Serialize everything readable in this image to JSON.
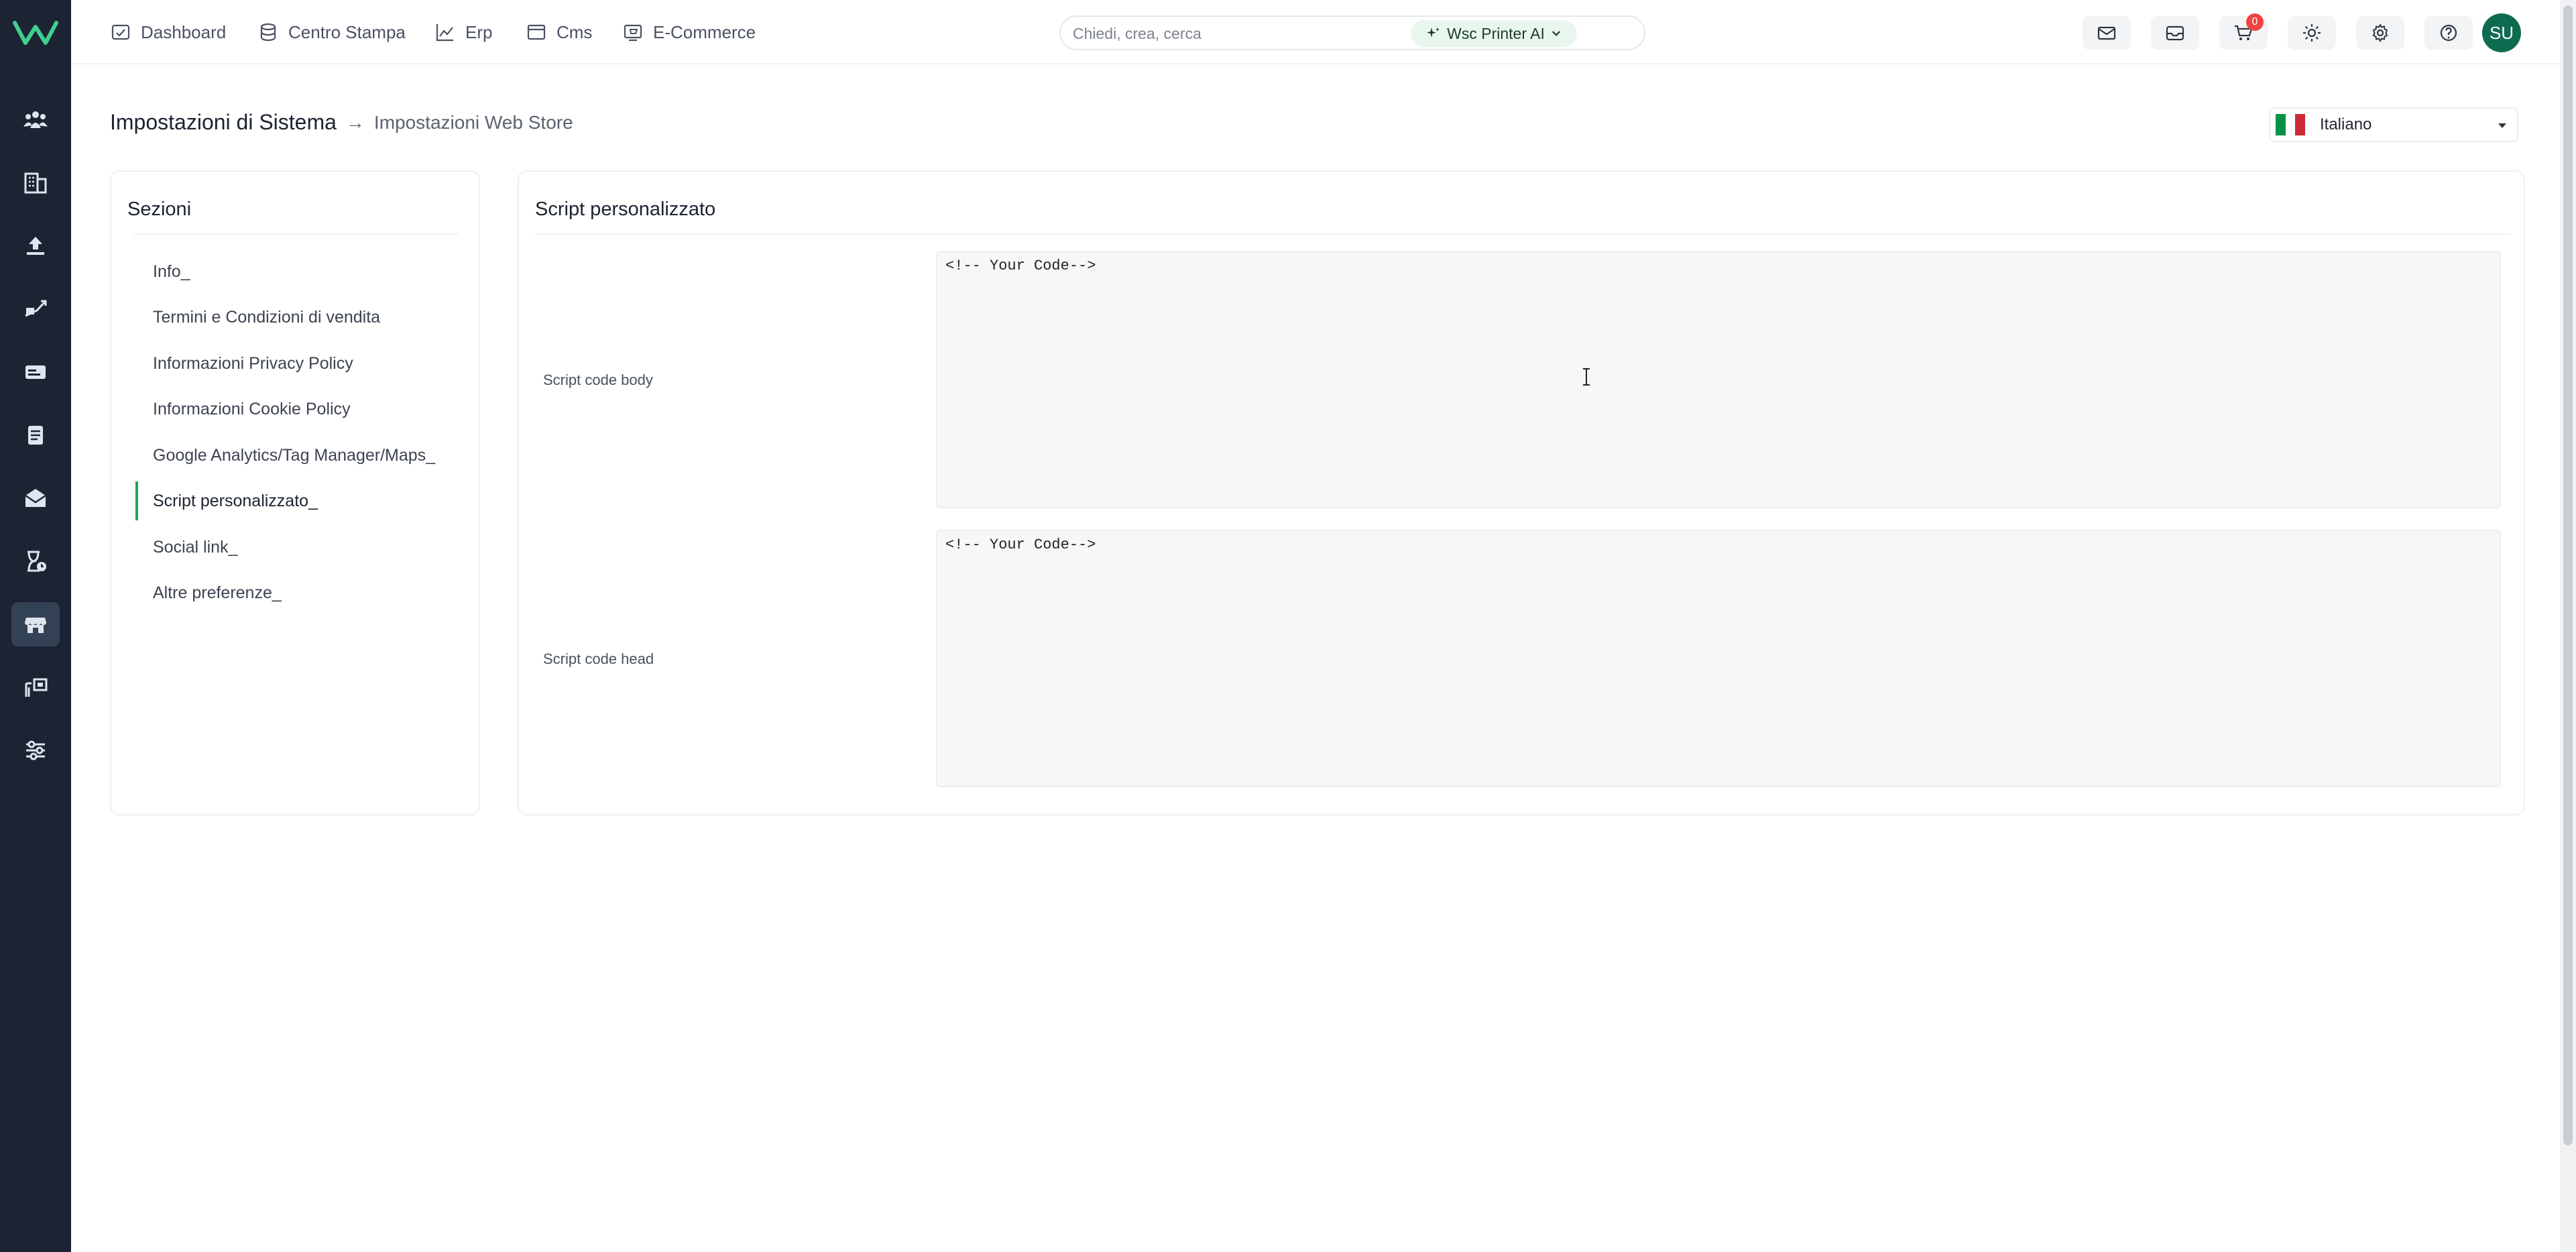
{
  "nav": [
    {
      "label": "Dashboard",
      "icon": "dashboard-icon"
    },
    {
      "label": "Centro Stampa",
      "icon": "database-icon"
    },
    {
      "label": "Erp",
      "icon": "chart-line-icon"
    },
    {
      "label": "Cms",
      "icon": "window-icon"
    },
    {
      "label": "E-Commerce",
      "icon": "ecommerce-icon"
    }
  ],
  "search": {
    "placeholder": "Chiedi, crea, cerca",
    "ai_label": "Wsc Printer AI"
  },
  "header_actions": {
    "cart_badge": "0",
    "avatar_initials": "SU"
  },
  "breadcrumb": {
    "main": "Impostazioni di Sistema",
    "separator": "→",
    "current": "Impostazioni Web Store"
  },
  "language": {
    "label": "Italiano",
    "flag_colors": [
      "#009246",
      "#ffffff",
      "#ce2b37"
    ]
  },
  "sections": {
    "title": "Sezioni",
    "items": [
      "Info_",
      "Termini e Condizioni di vendita",
      "Informazioni Privacy Policy",
      "Informazioni Cookie Policy",
      "Google Analytics/Tag Manager/Maps_",
      "Script personalizzato_",
      "Social link_",
      "Altre preferenze_"
    ],
    "active_index": 5
  },
  "content": {
    "title": "Script personalizzato",
    "fields": [
      {
        "label": "Script code body",
        "value": "<!-- Your Code-->"
      },
      {
        "label": "Script code head",
        "value": "<!-- Your Code-->"
      }
    ]
  },
  "colors": {
    "rail_bg": "#1c2434",
    "accent": "#22a35a",
    "avatar_bg": "#0f6b50",
    "badge": "#ef4444"
  }
}
